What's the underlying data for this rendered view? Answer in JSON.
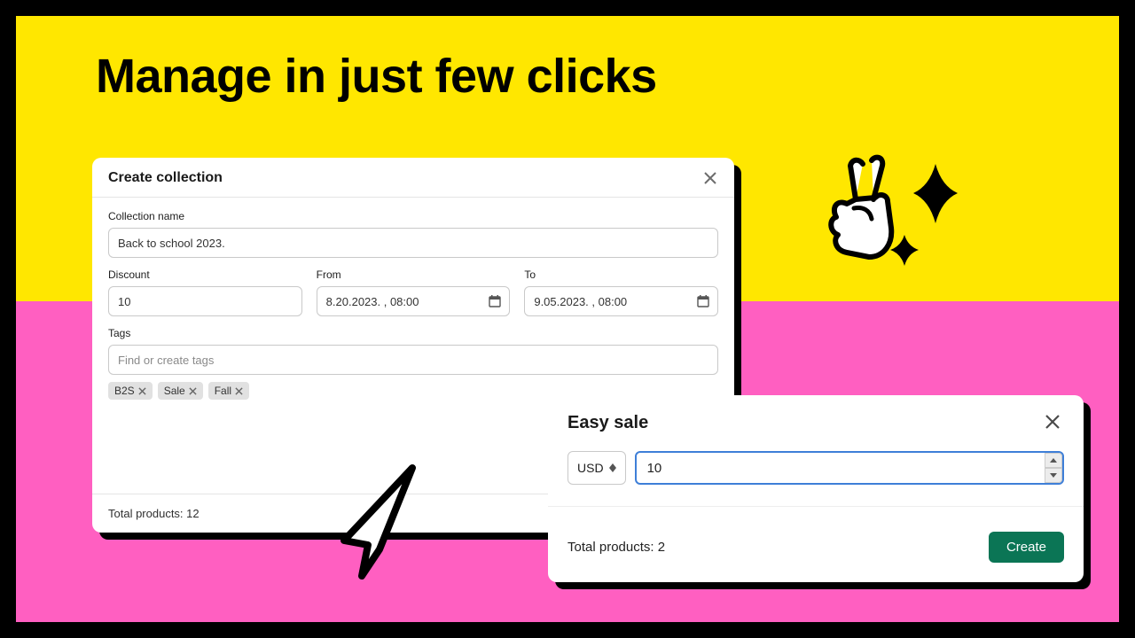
{
  "headline": "Manage in just few clicks",
  "create_collection": {
    "title": "Create collection",
    "name_label": "Collection name",
    "name_value": "Back to school 2023.",
    "discount_label": "Discount",
    "discount_value": "10",
    "from_label": "From",
    "from_value": "8.20.2023. , 08:00",
    "to_label": "To",
    "to_value": "9.05.2023. , 08:00",
    "tags_label": "Tags",
    "tags_placeholder": "Find or create tags",
    "tags": [
      "B2S",
      "Sale",
      "Fall"
    ],
    "total_label": "Total products: 12"
  },
  "easy_sale": {
    "title": "Easy sale",
    "currency": "USD",
    "amount": "10",
    "total_label": "Total products: 2",
    "create_label": "Create"
  }
}
